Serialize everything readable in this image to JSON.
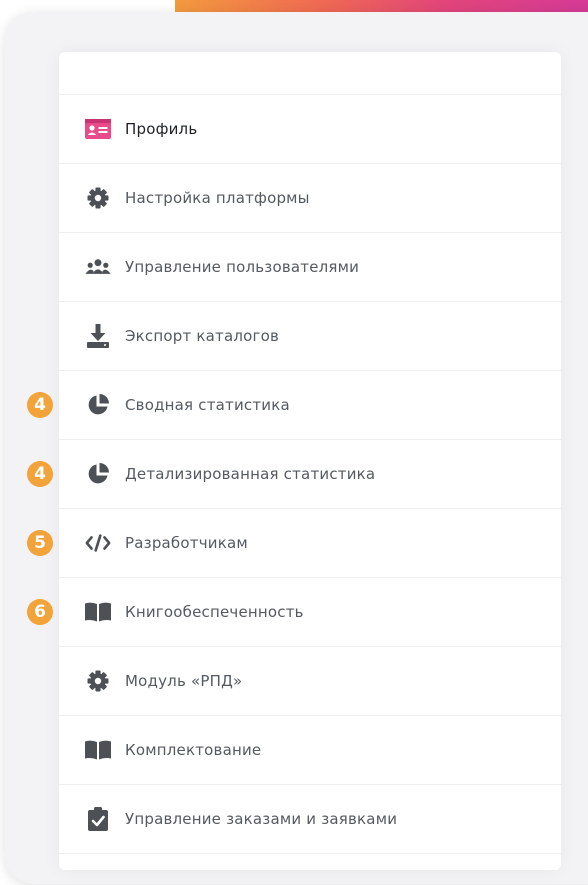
{
  "colors": {
    "accent_pink": "#e94a8a",
    "badge_orange": "#f2a33a",
    "icon_gray": "#4d5156",
    "text_gray": "#555a60",
    "text_dark": "#1f2226"
  },
  "menu": {
    "items": [
      {
        "label": "Профиль",
        "icon": "profile-card-icon",
        "active": true,
        "badge": null
      },
      {
        "label": "Настройка платформы",
        "icon": "gear-icon",
        "badge": null
      },
      {
        "label": "Управление пользователями",
        "icon": "users-icon",
        "badge": null
      },
      {
        "label": "Экспорт каталогов",
        "icon": "download-icon",
        "badge": null
      },
      {
        "label": "Сводная статистика",
        "icon": "pie-chart-icon",
        "badge": "4"
      },
      {
        "label": "Детализированная статистика",
        "icon": "pie-chart-icon",
        "badge": "4"
      },
      {
        "label": "Разработчикам",
        "icon": "code-icon",
        "badge": "5"
      },
      {
        "label": "Книгообеспеченность",
        "icon": "book-icon",
        "badge": "6"
      },
      {
        "label": "Модуль «РПД»",
        "icon": "gear-icon",
        "badge": null
      },
      {
        "label": "Комплектование",
        "icon": "book-icon",
        "badge": null
      },
      {
        "label": "Управление заказами и заявками",
        "icon": "clipboard-check-icon",
        "badge": null
      }
    ]
  }
}
